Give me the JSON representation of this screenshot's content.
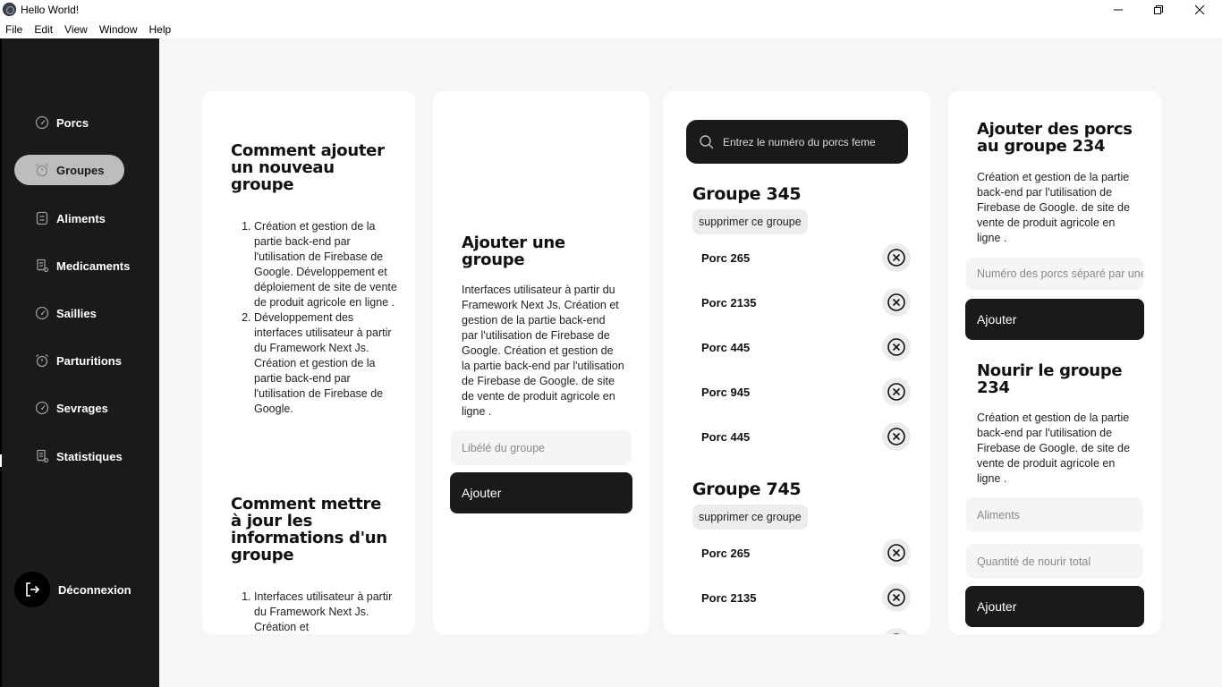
{
  "window": {
    "title": "Hello World!",
    "menu": [
      "File",
      "Edit",
      "View",
      "Window",
      "Help"
    ]
  },
  "sidebar": {
    "items": [
      {
        "label": "Porcs",
        "icon": "gauge-icon"
      },
      {
        "label": "Groupes",
        "icon": "alarm-clock-icon",
        "active": true
      },
      {
        "label": "Aliments",
        "icon": "box-icon"
      },
      {
        "label": "Medicaments",
        "icon": "receipt-icon"
      },
      {
        "label": "Saillies",
        "icon": "gauge-icon"
      },
      {
        "label": "Parturitions",
        "icon": "alarm-clock-icon"
      },
      {
        "label": "Sevrages",
        "icon": "gauge-icon"
      },
      {
        "label": "Statistiques",
        "icon": "receipt-icon"
      }
    ],
    "logout_label": "Déconnexion"
  },
  "help_card": {
    "title1": "Comment ajouter un nouveau groupe",
    "steps1": [
      "Création et gestion de la partie back-end par l'utilisation de Firebase de Google. Développement et déploiement de site de vente de produit agricole en ligne .",
      "Développement des interfaces utilisateur à partir du Framework Next Js. Création et gestion de la partie back-end par l'utilisation de Firebase de Google."
    ],
    "title2": "Comment mettre à jour les informations d'un groupe",
    "steps2": [
      "Interfaces utilisateur à partir du Framework Next Js. Création et"
    ]
  },
  "add_group_card": {
    "title": "Ajouter une groupe",
    "description": "Interfaces utilisateur à partir du Framework Next Js. Création et gestion de la partie back-end par l'utilisation de Firebase de Google. Création et gestion de la partie back-end par l'utilisation de Firebase de Google. de site de vente de produit agricole en ligne .",
    "input_placeholder": "Libélé du groupe",
    "button_label": "Ajouter"
  },
  "groups_card": {
    "search_placeholder": "Entrez le numéro du porcs femelle",
    "delete_label": "supprimer ce groupe",
    "groups": [
      {
        "title": "Groupe 345",
        "porcs": [
          "Porc 265",
          "Porc 2135",
          "Porc 445",
          "Porc 945",
          "Porc 445"
        ]
      },
      {
        "title": "Groupe 745",
        "porcs": [
          "Porc 265",
          "Porc 2135"
        ]
      }
    ]
  },
  "right_card": {
    "add_title": "Ajouter des porcs au groupe 234",
    "add_description": "Création et gestion de la partie back-end par l'utilisation de Firebase de Google. de site de vente de produit agricole en ligne .",
    "porcs_input_placeholder": "Numéro des porcs séparé par une virgule",
    "add_button": "Ajouter",
    "feed_title": "Nourir le groupe 234",
    "feed_description": "Création et gestion de la partie back-end par l'utilisation de Firebase de Google. de site de vente de produit agricole en ligne .",
    "aliments_placeholder": "Aliments",
    "quantity_placeholder": "Quantité de nourir total",
    "feed_button": "Ajouter"
  }
}
